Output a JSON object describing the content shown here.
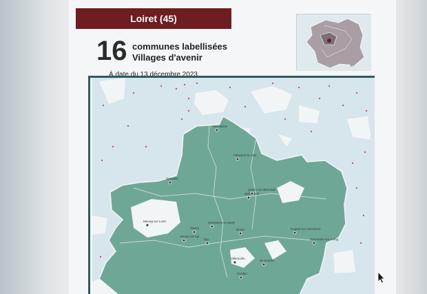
{
  "header": {
    "department": "Loiret (45)",
    "count": "16",
    "line1": "communes labellisées",
    "line2": "Villages d'avenir",
    "date": "À date du 13 décembre 2023"
  },
  "colors": {
    "banner": "#6e1d20",
    "region_fill": "#6fa797",
    "outside_fill": "#d7e6ec",
    "commune_dot": "#c64e8f"
  },
  "communes": [
    {
      "name": "Sermaises"
    },
    {
      "name": "Pithiviers-le-Vieil"
    },
    {
      "name": "Ouarville"
    },
    {
      "name": "Bellegarde"
    },
    {
      "name": "Quiers-sur-Bezonde"
    },
    {
      "name": "Meung-sur-Loire"
    },
    {
      "name": "Tavers"
    },
    {
      "name": "Dampierre-en-Burly"
    },
    {
      "name": "Vienne-en-Val"
    },
    {
      "name": "Tigy"
    },
    {
      "name": "Briare"
    },
    {
      "name": "Nogent-sur-Vernisson"
    },
    {
      "name": "Dammarie-sur-Loing"
    },
    {
      "name": "Villemurlin"
    },
    {
      "name": "St-Gondon"
    },
    {
      "name": "Cerdon"
    }
  ]
}
